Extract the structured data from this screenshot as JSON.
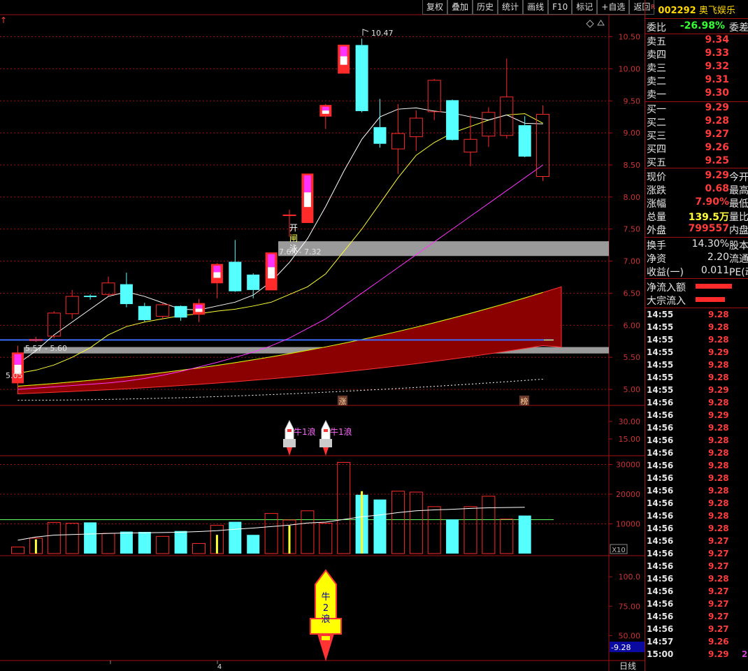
{
  "toolbar": [
    "复权",
    "叠加",
    "历史",
    "统计",
    "画线",
    "F10",
    "标记",
    "+自选",
    "返回"
  ],
  "chart_mark": "↑",
  "stock": {
    "sup": "R",
    "code": "002292",
    "name": "奥飞娱乐"
  },
  "wei": {
    "label1": "委比",
    "value": "-26.98%",
    "label2": "委差"
  },
  "sells": [
    {
      "label": "卖五",
      "price": "9.34"
    },
    {
      "label": "卖四",
      "price": "9.33"
    },
    {
      "label": "卖三",
      "price": "9.32"
    },
    {
      "label": "卖二",
      "price": "9.31"
    },
    {
      "label": "卖一",
      "price": "9.30"
    }
  ],
  "buys": [
    {
      "label": "买一",
      "price": "9.29"
    },
    {
      "label": "买二",
      "price": "9.28"
    },
    {
      "label": "买三",
      "price": "9.27"
    },
    {
      "label": "买四",
      "price": "9.26"
    },
    {
      "label": "买五",
      "price": "9.25"
    }
  ],
  "quote": [
    {
      "label": "现价",
      "value": "9.29",
      "right": "今开",
      "color": "red"
    },
    {
      "label": "涨跌",
      "value": "0.68",
      "right": "最高",
      "color": "red"
    },
    {
      "label": "涨幅",
      "value": "7.90%",
      "right": "最低",
      "color": "red"
    },
    {
      "label": "总量",
      "value": "139.5万",
      "right": "量比",
      "color": "yellow"
    },
    {
      "label": "外盘",
      "value": "799557",
      "right": "内盘",
      "color": "red"
    }
  ],
  "fund": [
    {
      "label": "换手",
      "value": "14.30%",
      "right": "股本"
    },
    {
      "label": "净资",
      "value": "2.20",
      "right": "流通"
    },
    {
      "label": "收益(一)",
      "value": "0.011",
      "right": "PE(动"
    }
  ],
  "flow": [
    {
      "label": "净流入额",
      "bar": 0.9
    },
    {
      "label": "大宗流入",
      "bar": 0.72
    }
  ],
  "ticks": [
    {
      "t": "14:55",
      "p": "9.28"
    },
    {
      "t": "14:55",
      "p": "9.28"
    },
    {
      "t": "14:55",
      "p": "9.28"
    },
    {
      "t": "14:55",
      "p": "9.29"
    },
    {
      "t": "14:55",
      "p": "9.28"
    },
    {
      "t": "14:55",
      "p": "9.28"
    },
    {
      "t": "14:55",
      "p": "9.29"
    },
    {
      "t": "14:56",
      "p": "9.28"
    },
    {
      "t": "14:56",
      "p": "9.29"
    },
    {
      "t": "14:56",
      "p": "9.28"
    },
    {
      "t": "14:56",
      "p": "9.28"
    },
    {
      "t": "14:56",
      "p": "9.28"
    },
    {
      "t": "14:56",
      "p": "9.28"
    },
    {
      "t": "14:56",
      "p": "9.28"
    },
    {
      "t": "14:56",
      "p": "9.28"
    },
    {
      "t": "14:56",
      "p": "9.28"
    },
    {
      "t": "14:56",
      "p": "9.28"
    },
    {
      "t": "14:56",
      "p": "9.28"
    },
    {
      "t": "14:56",
      "p": "9.27"
    },
    {
      "t": "14:56",
      "p": "9.27"
    },
    {
      "t": "14:56",
      "p": "9.27"
    },
    {
      "t": "14:56",
      "p": "9.28"
    },
    {
      "t": "14:56",
      "p": "9.27"
    },
    {
      "t": "14:56",
      "p": "9.27"
    },
    {
      "t": "14:56",
      "p": "9.27"
    },
    {
      "t": "14:56",
      "p": "9.27"
    },
    {
      "t": "14:57",
      "p": "9.26"
    },
    {
      "t": "15:00",
      "p": "9.29"
    }
  ],
  "tick_suffix": "2",
  "price_axis": [
    "10.50",
    "10.00",
    "9.50",
    "9.00",
    "8.50",
    "8.00",
    "7.50",
    "7.00",
    "6.50",
    "6.00",
    "5.50",
    "5.00"
  ],
  "ind1_axis": [
    "30.00",
    "15.00"
  ],
  "vol_axis": [
    "30000",
    "20000",
    "10000"
  ],
  "vol_unit": "X10",
  "ind2_axis": [
    "100.0",
    "75.00",
    "50.00"
  ],
  "cross_value": "-9.28",
  "period_label": "日线",
  "x_mark": "4",
  "annotations": {
    "high": "10.47",
    "low": "5.05",
    "gap1": "5.57 - 5.60",
    "gap2": "7.6X - 7.32",
    "kline_tags": [
      "开",
      "闸",
      "泳"
    ],
    "zhang": "涨",
    "bang": "榜",
    "rocket1": "牛1浪",
    "rocket2": "牛1浪",
    "big_rocket": [
      "牛",
      "2",
      "浪"
    ]
  },
  "colors": {
    "up": "#ff2a2a",
    "down": "#55ffff",
    "ma5": "#ffffff",
    "ma10": "#ffff33",
    "ma20": "#ff33ff",
    "grid": "#a01010"
  },
  "chart_data": {
    "type": "candlestick",
    "price_range": [
      4.75,
      10.8
    ],
    "candles": [
      {
        "o": 5.1,
        "h": 5.68,
        "l": 5.05,
        "c": 5.57,
        "mag": true
      },
      {
        "o": 5.76,
        "h": 5.82,
        "l": 5.74,
        "c": 5.78
      },
      {
        "o": 5.83,
        "h": 6.22,
        "l": 5.8,
        "c": 6.19
      },
      {
        "o": 6.18,
        "h": 6.55,
        "l": 6.1,
        "c": 6.45
      },
      {
        "o": 6.46,
        "h": 6.48,
        "l": 6.4,
        "c": 6.44
      },
      {
        "o": 6.48,
        "h": 6.76,
        "l": 6.45,
        "c": 6.66
      },
      {
        "o": 6.64,
        "h": 6.82,
        "l": 6.28,
        "c": 6.33
      },
      {
        "o": 6.3,
        "h": 6.35,
        "l": 6.06,
        "c": 6.08
      },
      {
        "o": 6.14,
        "h": 6.35,
        "l": 6.1,
        "c": 6.32
      },
      {
        "o": 6.3,
        "h": 6.31,
        "l": 6.07,
        "c": 6.12
      },
      {
        "o": 6.17,
        "h": 6.41,
        "l": 6.05,
        "c": 6.34,
        "mag": true
      },
      {
        "o": 6.66,
        "h": 6.97,
        "l": 6.42,
        "c": 6.95,
        "mag": true
      },
      {
        "o": 6.99,
        "h": 7.33,
        "l": 6.52,
        "c": 6.53
      },
      {
        "o": 6.79,
        "h": 6.81,
        "l": 6.42,
        "c": 6.55
      },
      {
        "o": 6.55,
        "h": 7.13,
        "l": 6.55,
        "c": 7.13,
        "mag": true
      },
      {
        "o": 7.72,
        "h": 7.8,
        "l": 7.38,
        "c": 7.72
      },
      {
        "o": 7.6,
        "h": 8.36,
        "l": 7.6,
        "c": 8.36,
        "mag": true
      },
      {
        "o": 9.26,
        "h": 9.45,
        "l": 9.06,
        "c": 9.43,
        "mag": true
      },
      {
        "o": 9.93,
        "h": 10.37,
        "l": 9.93,
        "c": 10.37,
        "mag": true
      },
      {
        "o": 10.37,
        "h": 10.47,
        "l": 9.32,
        "c": 9.34
      },
      {
        "o": 9.09,
        "h": 9.53,
        "l": 8.77,
        "c": 8.83
      },
      {
        "o": 8.75,
        "h": 9.45,
        "l": 8.36,
        "c": 8.99
      },
      {
        "o": 8.94,
        "h": 9.35,
        "l": 8.72,
        "c": 9.23
      },
      {
        "o": 9.33,
        "h": 9.84,
        "l": 9.2,
        "c": 9.82
      },
      {
        "o": 9.51,
        "h": 9.52,
        "l": 8.88,
        "c": 8.89
      },
      {
        "o": 8.7,
        "h": 9.28,
        "l": 8.48,
        "c": 8.9
      },
      {
        "o": 8.95,
        "h": 9.4,
        "l": 8.78,
        "c": 9.32
      },
      {
        "o": 8.96,
        "h": 10.16,
        "l": 8.91,
        "c": 9.56
      },
      {
        "o": 9.12,
        "h": 9.26,
        "l": 8.62,
        "c": 8.63
      },
      {
        "o": 8.32,
        "h": 9.43,
        "l": 8.25,
        "c": 9.29
      }
    ],
    "ma5": [
      5.4,
      5.6,
      5.85,
      6.05,
      6.25,
      6.45,
      6.52,
      6.45,
      6.35,
      6.25,
      6.24,
      6.3,
      6.36,
      6.47,
      6.68,
      6.98,
      7.35,
      7.85,
      8.4,
      8.9,
      9.25,
      9.37,
      9.39,
      9.34,
      9.31,
      9.25,
      9.2,
      9.28,
      9.15,
      9.14
    ],
    "ma10": [
      5.25,
      5.3,
      5.38,
      5.5,
      5.65,
      5.85,
      5.98,
      6.05,
      6.1,
      6.15,
      6.18,
      6.22,
      6.25,
      6.3,
      6.36,
      6.48,
      6.6,
      6.8,
      7.15,
      7.5,
      7.9,
      8.3,
      8.65,
      8.85,
      9.0,
      9.1,
      9.2,
      9.28,
      9.3,
      9.15
    ],
    "ma20": [
      5.0,
      5.02,
      5.04,
      5.06,
      5.08,
      5.1,
      5.13,
      5.17,
      5.22,
      5.28,
      5.35,
      5.42,
      5.5,
      5.58,
      5.68,
      5.8,
      5.95,
      6.1,
      6.3,
      6.5,
      6.7,
      6.9,
      7.1,
      7.3,
      7.5,
      7.7,
      7.9,
      8.1,
      8.3,
      8.5
    ],
    "volumes": [
      2200,
      5200,
      10500,
      10200,
      10500,
      6800,
      7400,
      7300,
      5800,
      7600,
      3400,
      9500,
      10700,
      6300,
      13500,
      11300,
      14400,
      10200,
      30700,
      19800,
      18200,
      21000,
      20700,
      15800,
      11500,
      15800,
      19300,
      11600,
      12800
    ],
    "vol_ma": [
      4500,
      5600,
      6200,
      6400,
      6600,
      6800,
      6900,
      7000,
      7100,
      7200,
      7400,
      7700,
      8200,
      8600,
      9100,
      9600,
      10300,
      10600,
      11500,
      12400,
      13000,
      13800,
      14400,
      14700,
      14900,
      15200,
      15400,
      15500,
      15600
    ],
    "vol_range": [
      0,
      32000
    ],
    "ind2_range": [
      30,
      115
    ]
  }
}
